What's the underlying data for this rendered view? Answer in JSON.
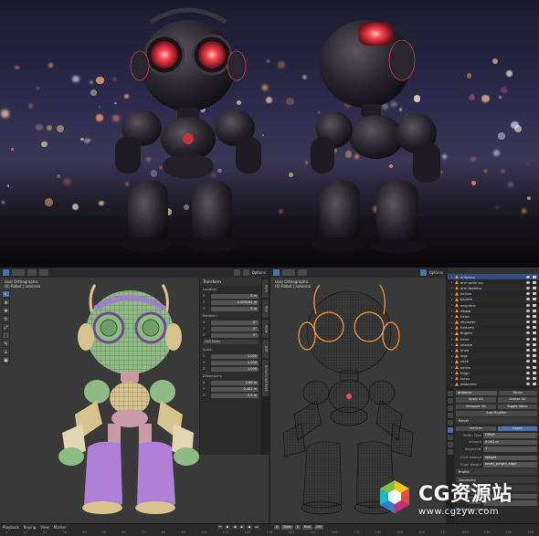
{
  "render_view": {
    "scene": "two robots with red glowing eyes in front of a blurred night city skyline"
  },
  "left_viewport": {
    "view_name": "User Orthographic",
    "object_label": "(0) Robot | antenna",
    "header_right": "Options",
    "sidebar_tabs": [
      "Item",
      "Tool",
      "View",
      "Edit",
      "Screencast Keys"
    ],
    "transform": {
      "title": "Transform",
      "location_label": "Location:",
      "location": [
        {
          "axis": "X",
          "value": "0 m"
        },
        {
          "axis": "Y",
          "value": "0.009162 m"
        },
        {
          "axis": "Z",
          "value": "0 m"
        }
      ],
      "rotation_label": "Rotation:",
      "rotation": [
        {
          "axis": "X",
          "value": "0°"
        },
        {
          "axis": "Y",
          "value": "0°"
        },
        {
          "axis": "Z",
          "value": "0°"
        }
      ],
      "rotation_mode": "XYZ Euler",
      "scale_label": "Scale:",
      "scale": [
        {
          "axis": "X",
          "value": "1.000"
        },
        {
          "axis": "Y",
          "value": "1.000"
        },
        {
          "axis": "Z",
          "value": "1.000"
        }
      ],
      "dimensions_label": "Dimensions:",
      "dimensions": [
        {
          "axis": "X",
          "value": "2.68 m"
        },
        {
          "axis": "Y",
          "value": "0.481 m"
        },
        {
          "axis": "Z",
          "value": "3.5 m"
        }
      ]
    }
  },
  "right_viewport": {
    "view_name": "User Orthographic",
    "object_label": "(0) Robot | antenna",
    "header_right": "Options"
  },
  "outliner": {
    "items": [
      {
        "name": "antenna",
        "selected": true
      },
      {
        "name": "arm.antenna",
        "selected": false
      },
      {
        "name": "arm.footsho",
        "selected": false
      },
      {
        "name": "bellow",
        "selected": false
      },
      {
        "name": "bauble",
        "selected": false
      },
      {
        "name": "earpiece",
        "selected": false
      },
      {
        "name": "elbow",
        "selected": false
      },
      {
        "name": "head",
        "selected": false
      },
      {
        "name": "shoulder",
        "selected": false
      },
      {
        "name": "forearm",
        "selected": false
      },
      {
        "name": "fingers",
        "selected": false
      },
      {
        "name": "hand",
        "selected": false
      },
      {
        "name": "handle",
        "selected": false
      },
      {
        "name": "knee",
        "selected": false
      },
      {
        "name": "legs",
        "selected": false
      },
      {
        "name": "neck",
        "selected": false
      },
      {
        "name": "pelvis",
        "selected": false
      },
      {
        "name": "thigh",
        "selected": false
      },
      {
        "name": "torso",
        "selected": false
      },
      {
        "name": "abdomen",
        "selected": false
      }
    ]
  },
  "properties": {
    "object_name": "antenna",
    "mirror_label": "Mirror",
    "buttons_row1": [
      "Apply All",
      "Delete All"
    ],
    "buttons_row2": [
      "Viewport Vis",
      "Toggle Stack"
    ],
    "add_modifier": "Add Modifier",
    "modifier_name": "Bevel",
    "mode_tabs": [
      "Vertices",
      "Edges"
    ],
    "fields": [
      {
        "label": "Width Type",
        "value": "Offset"
      },
      {
        "label": "Amount",
        "value": "0.003 m"
      },
      {
        "label": "Segments",
        "value": "1"
      }
    ],
    "limit_fields": [
      {
        "label": "Limit Method",
        "value": "Weight"
      },
      {
        "label": "Edge Weight",
        "value": "bevel_weight_edge"
      }
    ],
    "sections": [
      "Profile",
      "Geometry",
      "Shading"
    ],
    "subdiv_fields": [
      {
        "label": "Levels Viewport",
        "value": "1"
      },
      {
        "label": "Render",
        "value": "2"
      }
    ],
    "optimal_display": "Optimal Display"
  },
  "timeline": {
    "menus": [
      "Playback",
      "Keying",
      "View",
      "Marker"
    ],
    "frame": "0",
    "start_label": "Start",
    "start": "1",
    "end_label": "End",
    "end": "250",
    "ruler": [
      "0",
      "10",
      "20",
      "30",
      "40",
      "50",
      "60",
      "70",
      "80",
      "90",
      "100",
      "110",
      "120",
      "130",
      "140",
      "150",
      "160",
      "170",
      "180",
      "190",
      "200",
      "210",
      "220",
      "230",
      "240",
      "250"
    ]
  },
  "watermark": {
    "brand": "CG资源站",
    "url": "www.cgzyw.com"
  },
  "colors": {
    "selection": "#334d80",
    "active_button": "#4772b3",
    "eye_glow": "#ff3a44",
    "wire_highlight": "#ff9c36"
  }
}
